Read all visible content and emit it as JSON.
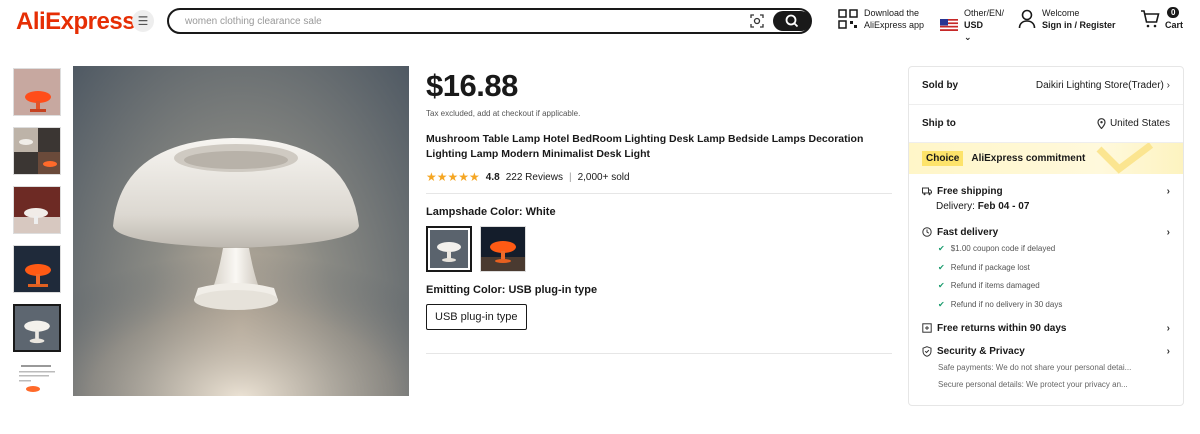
{
  "header": {
    "logo": "AliExpress",
    "search_placeholder": "women clothing clearance sale",
    "app_line1": "Download the",
    "app_line2": "AliExpress app",
    "locale_line1": "Other/EN/",
    "locale_line2": "USD",
    "account_line1": "Welcome",
    "account_line2": "Sign in / Register",
    "cart_label": "Cart",
    "cart_count": "0"
  },
  "product": {
    "price": "$16.88",
    "tax_note": "Tax excluded, add at checkout if applicable.",
    "title": "Mushroom Table Lamp Hotel BedRoom Lighting Desk Lamp Bedside Lamps Decoration Lighting Lamp Modern Minimalist Desk Light",
    "rating": "4.8",
    "reviews": "222 Reviews",
    "divider": "|",
    "sold": "2,000+ sold",
    "lampshade_label": "Lampshade Color: White",
    "emitting_label": "Emitting Color: USB plug-in type",
    "emitting_option": "USB plug-in type"
  },
  "panel": {
    "sold_by_label": "Sold by",
    "store": "Daikiri Lighting Store(Trader)",
    "ship_to_label": "Ship to",
    "ship_to": "United States",
    "choice_tag": "Choice",
    "commitment": "AliExpress commitment",
    "free_shipping": "Free shipping",
    "delivery_label": "Delivery:",
    "delivery_dates": "Feb 04 - 07",
    "fast_delivery": "Fast delivery",
    "fast_items": [
      "$1.00 coupon code if delayed",
      "Refund if package lost",
      "Refund if items damaged",
      "Refund if no delivery in 30 days"
    ],
    "free_returns": "Free returns within 90 days",
    "security": "Security & Privacy",
    "security_items": [
      "Safe payments: We do not share your personal detai...",
      "Secure personal details: We protect your privacy an..."
    ]
  },
  "colors": {
    "brand_red": "#e62e04",
    "star": "#f5a623",
    "choice_yellow": "#fde36a"
  }
}
